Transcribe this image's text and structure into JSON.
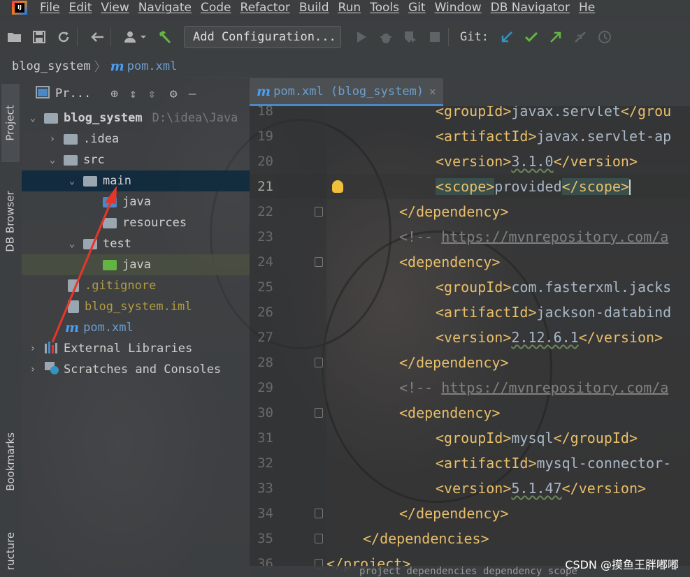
{
  "menu": [
    "File",
    "Edit",
    "View",
    "Navigate",
    "Code",
    "Refactor",
    "Build",
    "Run",
    "Tools",
    "Git",
    "Window",
    "DB Navigator",
    "He"
  ],
  "toolbar": {
    "add_config_label": "Add Configuration...",
    "git_label": "Git:"
  },
  "breadcrumb": {
    "project": "blog_system",
    "file": "pom.xml"
  },
  "left_strip": {
    "project_tab": "Project",
    "db_browser_tab": "DB Browser",
    "bookmarks_tab": "Bookmarks",
    "structure_tab": "ructure"
  },
  "project_panel": {
    "title": "Pr...",
    "tree": [
      {
        "label": "blog_system",
        "extra": "D:\\idea\\Java",
        "chevron": "⌄"
      },
      {
        "label": ".idea",
        "chevron": "›"
      },
      {
        "label": "src",
        "chevron": "⌄"
      },
      {
        "label": "main",
        "chevron": "⌄"
      },
      {
        "label": "java",
        "chevron": ""
      },
      {
        "label": "resources",
        "chevron": ""
      },
      {
        "label": "test",
        "chevron": "⌄"
      },
      {
        "label": "java",
        "chevron": ""
      },
      {
        "label": ".gitignore",
        "chevron": ""
      },
      {
        "label": "blog_system.iml",
        "chevron": ""
      },
      {
        "label": "pom.xml",
        "chevron": ""
      },
      {
        "label": "External Libraries",
        "chevron": "›"
      },
      {
        "label": "Scratches and Consoles",
        "chevron": "›"
      }
    ]
  },
  "editor": {
    "tab_label": "pom.xml (blog_system)",
    "lines": [
      {
        "n": "18",
        "indent": 2,
        "open": "<groupId>",
        "text": "javax.servlet",
        "close": "</grou"
      },
      {
        "n": "19",
        "indent": 2,
        "open": "<artifactId>",
        "text": "javax.servlet-ap",
        "close": ""
      },
      {
        "n": "20",
        "indent": 2,
        "open": "<version>",
        "text": "3.1.0",
        "close": "</version>"
      },
      {
        "n": "21",
        "indent": 2,
        "open": "<scope>",
        "text": "provided",
        "close": "</scope>"
      },
      {
        "n": "22",
        "indent": 1,
        "open": "</dependency>",
        "text": "",
        "close": ""
      },
      {
        "n": "23",
        "indent": 1,
        "comment": "<!-- ",
        "link": "https://mvnrepository.com/a"
      },
      {
        "n": "24",
        "indent": 1,
        "open": "<dependency>",
        "text": "",
        "close": ""
      },
      {
        "n": "25",
        "indent": 2,
        "open": "<groupId>",
        "text": "com.fasterxml.jacks",
        "close": ""
      },
      {
        "n": "26",
        "indent": 2,
        "open": "<artifactId>",
        "text": "jackson-databind",
        "close": ""
      },
      {
        "n": "27",
        "indent": 2,
        "open": "<version>",
        "text": "2.12.6.1",
        "close": "</version>"
      },
      {
        "n": "28",
        "indent": 1,
        "open": "</dependency>",
        "text": "",
        "close": ""
      },
      {
        "n": "29",
        "indent": 1,
        "comment": "<!-- ",
        "link": "https://mvnrepository.com/a"
      },
      {
        "n": "30",
        "indent": 1,
        "open": "<dependency>",
        "text": "",
        "close": ""
      },
      {
        "n": "31",
        "indent": 2,
        "open": "<groupId>",
        "text": "mysql",
        "close": "</groupId>"
      },
      {
        "n": "32",
        "indent": 2,
        "open": "<artifactId>",
        "text": "mysql-connector-",
        "close": ""
      },
      {
        "n": "33",
        "indent": 2,
        "open": "<version>",
        "text": "5.1.47",
        "close": "</version>"
      },
      {
        "n": "34",
        "indent": 1,
        "open": "</dependency>",
        "text": "",
        "close": ""
      },
      {
        "n": "35",
        "indent": 0,
        "open": "</dependencies>",
        "text": "",
        "close": ""
      },
      {
        "n": "36",
        "indent": -1,
        "open": "</project>",
        "text": "",
        "close": ""
      }
    ]
  },
  "status_breadcrumb": "project  dependencies  dependency  scope",
  "watermark": "CSDN @摸鱼王胖嘟嘟",
  "colors": {
    "tag": "#e8bf6a",
    "text": "#a9b7c6",
    "comment": "#808080",
    "selection": "#0d293e",
    "accent": "#4a88c7",
    "arrow": "#e8352a"
  }
}
